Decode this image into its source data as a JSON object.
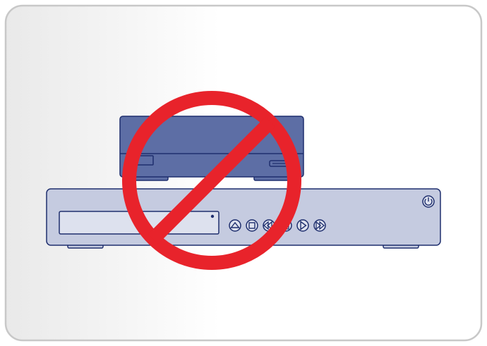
{
  "colors": {
    "frame_border": "#c8c8c8",
    "background_gradient_start": "#e9e9e9",
    "background_gradient_end": "#ffffff",
    "top_device_fill": "#5d6ea5",
    "device_outline": "#1f2f6e",
    "bottom_device_fill": "#c5cbe0",
    "panel_fill": "#dde1ee",
    "prohibition_red": "#e8232b"
  },
  "icons": {
    "top_device": "external-hard-drive-icon",
    "bottom_device": "dvd-player-icon",
    "prohibition": "prohibition-sign-icon",
    "buttons": [
      "eject-icon",
      "stop-icon",
      "rewind-icon",
      "pause-icon",
      "play-icon",
      "fast-forward-icon"
    ],
    "power": "power-icon"
  }
}
